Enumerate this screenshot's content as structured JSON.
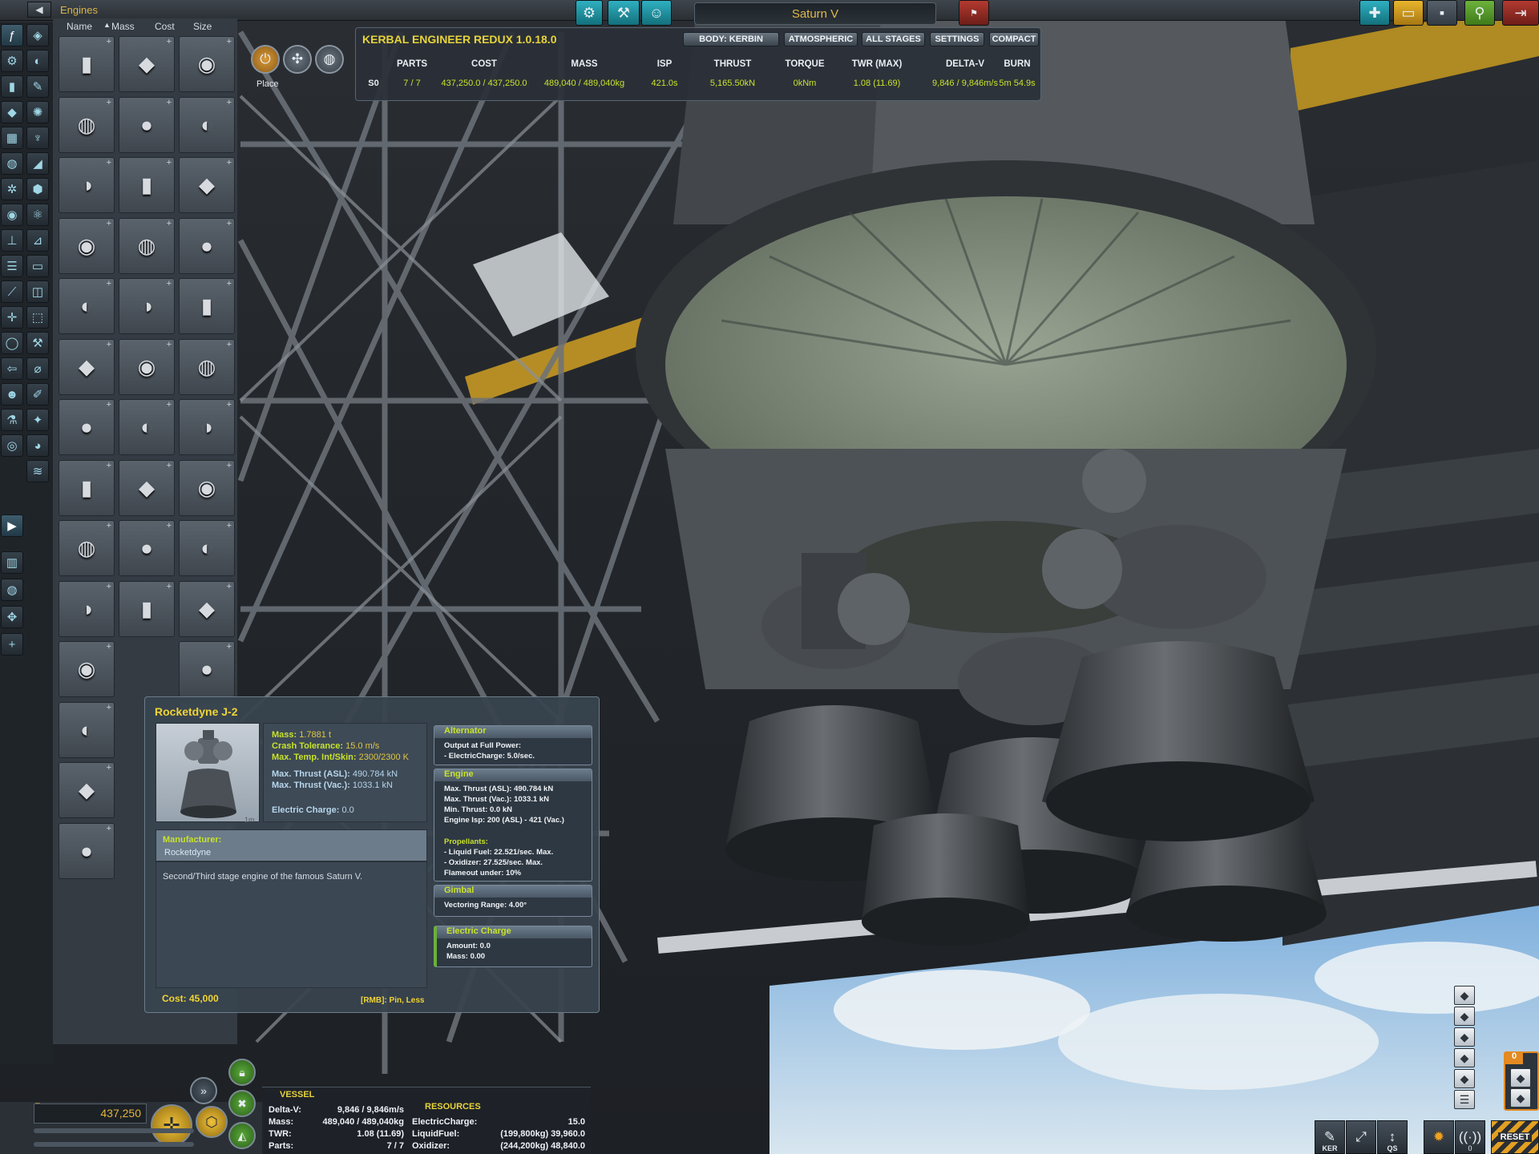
{
  "toolbar": {
    "category": "Engines",
    "ship_name": "Saturn V"
  },
  "parts_panel": {
    "sort_headers": [
      "Name",
      "Mass",
      "Cost",
      "Size"
    ]
  },
  "ker": {
    "title": "KERBAL ENGINEER REDUX 1.0.18.0",
    "buttons": [
      "BODY: KERBIN",
      "ATMOSPHERIC",
      "ALL STAGES",
      "SETTINGS",
      "COMPACT"
    ],
    "headers": [
      "PARTS",
      "COST",
      "MASS",
      "ISP",
      "THRUST",
      "TORQUE",
      "TWR (MAX)",
      "DELTA-V",
      "BURN"
    ],
    "stage": "S0",
    "values": [
      "7 / 7",
      "437,250.0 / 437,250.0",
      "489,040 / 489,040kg",
      "421.0s",
      "5,165.50kN",
      "0kNm",
      "1.08 (11.69)",
      "9,846 / 9,846m/s",
      "5m 54.9s"
    ]
  },
  "place_tools": {
    "label": "Place"
  },
  "tooltip": {
    "title": "Rocketdyne J-2",
    "size": "1m",
    "stats": {
      "mass_label": "Mass:",
      "mass": "1.7881 t",
      "crash_label": "Crash Tolerance:",
      "crash": "15.0 m/s",
      "temp_label": "Max. Temp. Int/Skin:",
      "temp": "2300/2300 K",
      "thrust_asl_label": "Max. Thrust (ASL):",
      "thrust_asl": "490.784 kN",
      "thrust_vac_label": "Max. Thrust (Vac.):",
      "thrust_vac": "1033.1 kN",
      "ec_label": "Electric Charge:",
      "ec": "0.0"
    },
    "manufacturer_label": "Manufacturer:",
    "manufacturer": "Rocketdyne",
    "description": "Second/Third stage engine of the famous Saturn V.",
    "cost": "Cost: 45,000",
    "rmb": "[RMB]: Pin, Less",
    "modules": [
      {
        "name": "Alternator",
        "text": "Output at Full Power:\n- ElectricCharge: 5.0/sec."
      },
      {
        "name": "Engine",
        "text": "Max. Thrust (ASL): 490.784 kN\nMax. Thrust (Vac.): 1033.1 kN\nMin. Thrust: 0.0 kN\nEngine Isp: 200 (ASL) - 421 (Vac.)",
        "sub": "Propellants:",
        "text2": "- Liquid Fuel: 22.521/sec. Max.\n- Oxidizer: 27.525/sec. Max.\nFlameout under: 10%"
      },
      {
        "name": "Gimbal",
        "text": "Vectoring Range: 4.00°"
      },
      {
        "name": "Electric Charge",
        "text": "Amount: 0.0\nMass: 0.00"
      }
    ]
  },
  "bottom": {
    "cost": "437,250",
    "vessel_title": "VESSEL",
    "resources_title": "RESOURCES",
    "vessel": [
      {
        "label": "Delta-V:",
        "value": "9,846 / 9,846m/s"
      },
      {
        "label": "Mass:",
        "value": "489,040 / 489,040kg"
      },
      {
        "label": "TWR:",
        "value": "1.08 (11.69)"
      },
      {
        "label": "Parts:",
        "value": "7 / 7"
      }
    ],
    "resources": [
      {
        "label": "ElectricCharge:",
        "value": "15.0"
      },
      {
        "label": "LiquidFuel:",
        "value": "(199,800kg) 39,960.0"
      },
      {
        "label": "Oxidizer:",
        "value": "(244,200kg) 48,840.0"
      }
    ],
    "stage_count": "0",
    "ker_label": "KER",
    "qs_label": "QS",
    "comm_label": "0",
    "reset_label": "RESET"
  },
  "colors": {
    "accent_yellow": "#e6d33a",
    "value_green": "#c8e22b",
    "ship_name": "#e0b84a"
  }
}
